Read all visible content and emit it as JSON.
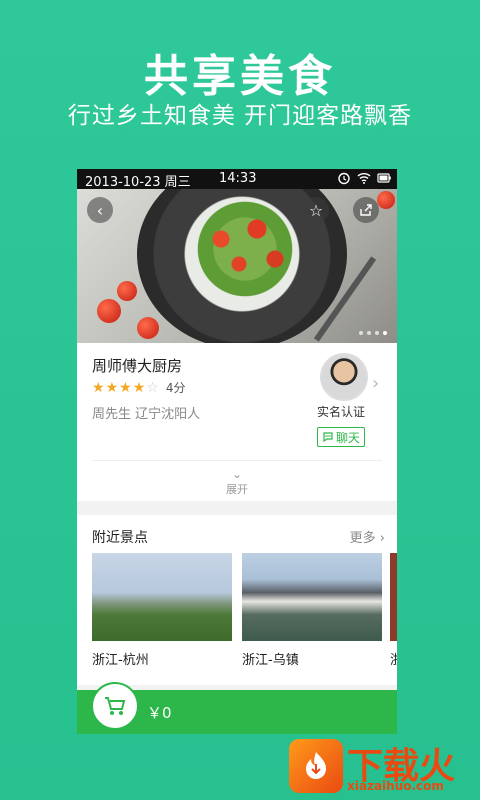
{
  "headline": "共享美食",
  "subheadline": "行过乡土知食美  开门迎客路飘香",
  "status_bar": {
    "date": "2013-10-23 周三",
    "time": "14:33"
  },
  "hero": {
    "dots_count": 4,
    "active_dot": 3
  },
  "chef": {
    "name": "周师傅大厨房",
    "rating_value": 4,
    "rating_max": 5,
    "rating_text": "4分",
    "meta": "周先生  辽宁沈阳人",
    "verified_label": "实名认证",
    "chat_label": "聊天"
  },
  "expand_label": "展开",
  "nearby": {
    "title": "附近景点",
    "more_label": "更多",
    "items": [
      {
        "caption": "浙江-杭州"
      },
      {
        "caption": "浙江-乌镇"
      },
      {
        "caption": "浙"
      }
    ]
  },
  "cart": {
    "total": "￥0"
  },
  "watermark": {
    "title": "下载火",
    "site": "xiazaihuo.com"
  },
  "colors": {
    "brand_green": "#2db74a",
    "background": "#2ec89a",
    "star": "#f5a623"
  }
}
